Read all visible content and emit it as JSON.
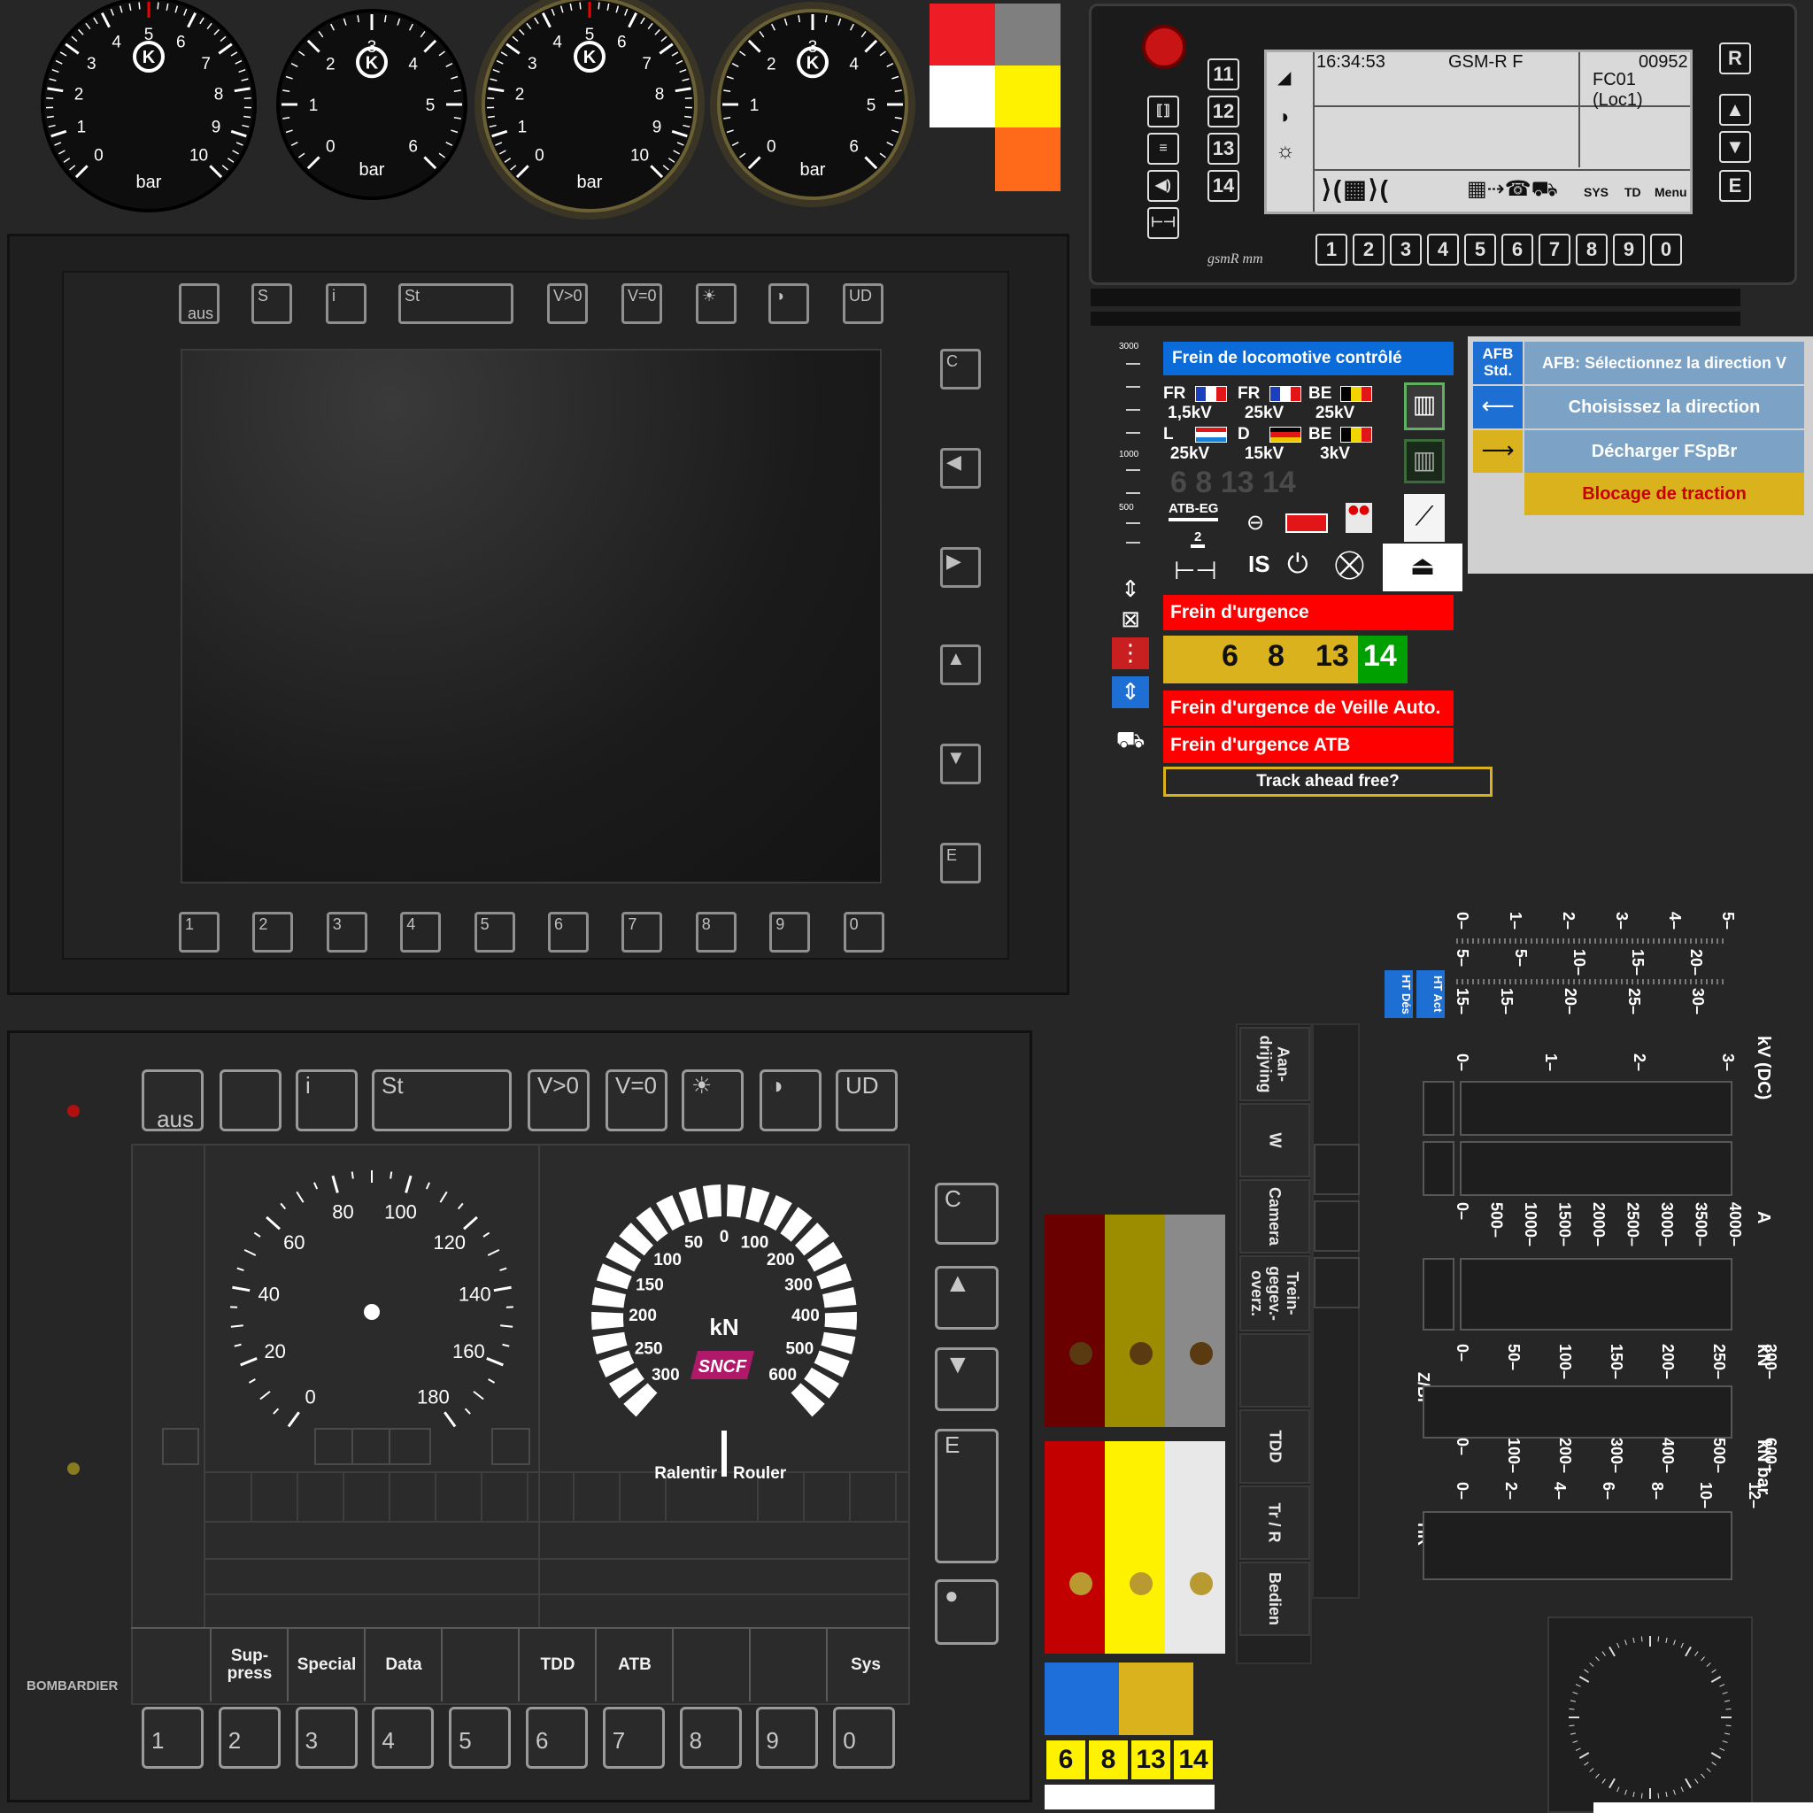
{
  "gauges": [
    {
      "labels": [
        "0",
        "1",
        "2",
        "3",
        "4",
        "5",
        "6",
        "7",
        "8",
        "9",
        "10"
      ],
      "unit": "bar"
    },
    {
      "labels": [
        "0",
        "1",
        "2",
        "3",
        "4",
        "5",
        "6"
      ],
      "unit": "bar"
    },
    {
      "labels": [
        "0",
        "1",
        "2",
        "3",
        "4",
        "5",
        "6",
        "7",
        "8",
        "9",
        "10"
      ],
      "unit": "bar"
    },
    {
      "labels": [
        "0",
        "1",
        "2",
        "3",
        "4",
        "5",
        "6"
      ],
      "unit": "bar"
    }
  ],
  "color_blocks": {
    "red": "#ee1c24",
    "gray": "#7f7f7f",
    "white": "#ffffff",
    "yellow": "#fff200",
    "orange": "#ff6a1a"
  },
  "gsm": {
    "time": "16:34:53",
    "network": "GSM-R F",
    "number": "00952",
    "train_id": "FC01 (Loc1)",
    "left_keys": [
      "11",
      "12",
      "13",
      "14"
    ],
    "right_keys": [
      "R",
      "E"
    ],
    "bottom_keys": [
      "1",
      "2",
      "3",
      "4",
      "5",
      "6",
      "7",
      "8",
      "9",
      "0"
    ],
    "soft_sys": "SYS",
    "soft_td": "TD",
    "soft_menu": "Menu",
    "brand": "gsmR mm"
  },
  "dmi_top": {
    "buttons": [
      "aus",
      "S",
      "i",
      "St",
      "V>0",
      "V=0",
      "☀",
      "◑",
      "UD"
    ],
    "right_buttons": [
      "C",
      "E"
    ],
    "numbers": [
      "1",
      "2",
      "3",
      "4",
      "5",
      "6",
      "7",
      "8",
      "9",
      "0"
    ]
  },
  "panel": {
    "loco_brake": "Frein de locomotive contrôlé",
    "systems": [
      {
        "code": "FR",
        "voltage": "1,5kV"
      },
      {
        "code": "FR",
        "voltage": "25kV"
      },
      {
        "code": "BE",
        "voltage": "25kV"
      },
      {
        "code": "L",
        "voltage": "25kV"
      },
      {
        "code": "D",
        "voltage": "15kV"
      },
      {
        "code": "BE",
        "voltage": "3kV"
      }
    ],
    "gray_numbers": "6 8 13 14",
    "atb_eg": "ATB-EG",
    "atb_num": "2",
    "is_label": "IS",
    "scale_labels": [
      "3000",
      "1000",
      "500"
    ],
    "emergency": "Frein d'urgence",
    "digits": [
      "6",
      "8",
      "13",
      "14"
    ],
    "emergency_auto": "Frein d'urgence de Veille Auto.",
    "emergency_atb": "Frein d'urgence ATB",
    "track_free": "Track ahead free?"
  },
  "afb": {
    "std_label": "AFB\nStd.",
    "rows": [
      "AFB: Sélectionnez la direction V",
      "Choisissez la direction",
      "Décharger FSpBr",
      "Blocage de traction"
    ]
  },
  "dmi_bottom": {
    "buttons": [
      "aus",
      "",
      "i",
      "St",
      "V>0",
      "V=0",
      "☀",
      "◑",
      "UD"
    ],
    "right_buttons": [
      "C",
      "E"
    ],
    "speed_labels": [
      "0",
      "20",
      "40",
      "60",
      "80",
      "100",
      "120",
      "140",
      "160",
      "180"
    ],
    "force_labels": [
      "0",
      "50",
      "100",
      "150",
      "200",
      "250",
      "300",
      "400",
      "500",
      "600"
    ],
    "force_labels_left": [
      "50",
      "100",
      "150",
      "200",
      "250",
      "300"
    ],
    "force_unit": "kN",
    "brand": "SNCF",
    "slow": "Ralentir",
    "roll": "Rouler",
    "softkeys": [
      "",
      "Sup-\npress",
      "Special",
      "Data",
      "",
      "TDD",
      "ATB",
      "",
      "",
      "Sys"
    ],
    "numbers": [
      "1",
      "2",
      "3",
      "4",
      "5",
      "6",
      "7",
      "8",
      "9",
      "0"
    ],
    "maker": "BOMBARDIER"
  },
  "side_tabs": [
    "Aan-\ndrijving",
    "W",
    "Camera",
    "Trein-\ngegev.-\noverz.",
    "",
    "TDD",
    "Tr / R",
    "Bedien",
    ""
  ],
  "ht": [
    "HT Dés",
    "HT Act"
  ],
  "scales": {
    "top_a": [
      "0",
      "1",
      "2",
      "3",
      "4",
      "5"
    ],
    "top_b": [
      "5",
      "10",
      "15",
      "20"
    ],
    "top_c": [
      "15",
      "20",
      "25",
      "30"
    ],
    "kv_labels": [
      "0",
      "1",
      "2",
      "3"
    ],
    "kv_unit": "kV (DC)",
    "amp_labels": [
      "0",
      "500",
      "1000",
      "1500",
      "2000",
      "2500",
      "3000",
      "3500",
      "4000"
    ],
    "amp_unit": "A",
    "kn_labels": [
      "0",
      "50",
      "100",
      "150",
      "200",
      "250",
      "300"
    ],
    "kn_unit": "kN",
    "zbr": "Z/Br",
    "kn2_labels": [
      "0",
      "100",
      "200",
      "300",
      "400",
      "500",
      "600"
    ],
    "kn2_unit": "kN bar",
    "bar_labels": [
      "0",
      "2",
      "4",
      "6",
      "8",
      "10",
      "12"
    ],
    "hr": "HR"
  },
  "lamps": {
    "top": [
      "#6b0000",
      "#9c8c00",
      "#8a8a8a"
    ],
    "bottom": [
      "#c30000",
      "#fff200",
      "#e8e8e8"
    ],
    "small": [
      "#1e6fd9",
      "#d9b21e"
    ],
    "digits": [
      "6",
      "8",
      "13",
      "14"
    ]
  }
}
